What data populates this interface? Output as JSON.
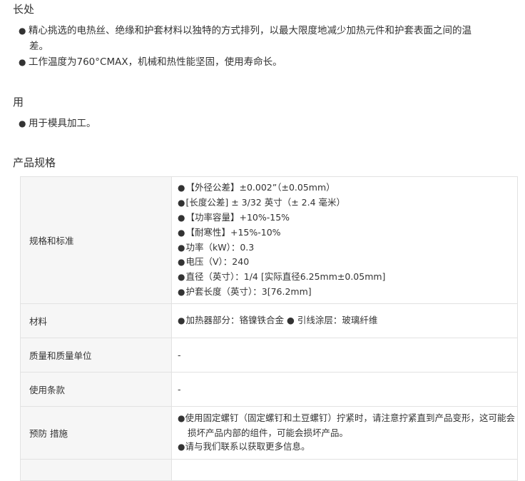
{
  "sections": {
    "advantages_heading": "长处",
    "advantages": [
      "精心挑选的电热丝、绝缘和护套材料以独特的方式排列，以最大限度地减少加热元件和护套表面之间的温",
      "差。",
      "工作温度为760°CMAX，机械和热性能坚固，使用寿命长。"
    ],
    "use_heading": "用",
    "uses": [
      "用于模具加工。"
    ],
    "spec_heading": "产品规格"
  },
  "bullet_symbol": "●",
  "spec_table": {
    "rows": [
      {
        "key": "规格和标准",
        "values": [
          "【外径公差】±0.002”（±0.05mm）",
          "[长度公差] ± 3/32 英寸（± 2.4 毫米）",
          "【功率容量】+10%-15%",
          "【耐寒性】+15%-10%",
          "功率（kW）：0.3",
          "电压（V）：240",
          "直径（英寸）：1/4 [实际直径6.25mm±0.05mm]",
          "护套长度（英寸）：3[76.2mm]"
        ]
      },
      {
        "key": "材料",
        "values": [
          "加热器部分：铬镍铁合金 ● 引线涂层：玻璃纤维"
        ]
      },
      {
        "key": "质量和质量单位",
        "text": "-"
      },
      {
        "key": "使用条款",
        "text": "-"
      },
      {
        "key": "预防 措施",
        "precautions": {
          "first": "使用固定螺钉（固定螺钉和土豆螺钉）拧紧时，请注意拧紧直到产品变形，这可能会",
          "first_cont": "损坏产品内部的组件，可能会损坏产品。",
          "second": "请与我们联系以获取更多信息。"
        }
      }
    ]
  }
}
